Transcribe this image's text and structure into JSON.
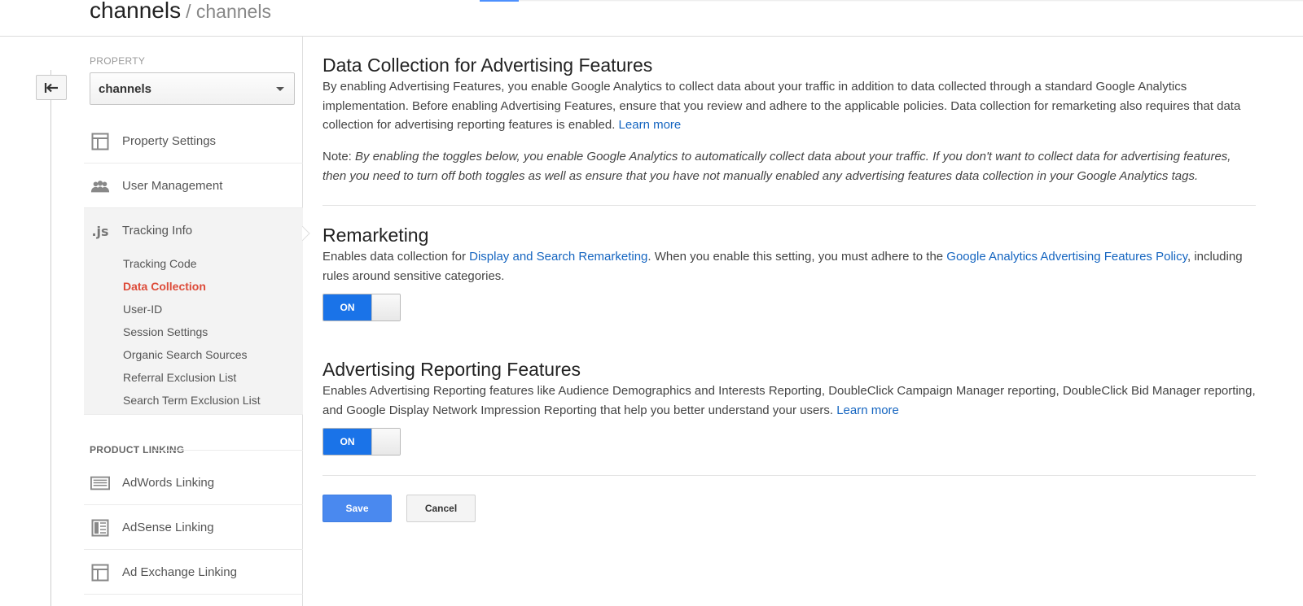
{
  "header": {
    "title": "channels",
    "breadcrumb": "/ channels"
  },
  "sidebar": {
    "property_heading": "PROPERTY",
    "property_select_value": "channels",
    "items": [
      {
        "label": "Property Settings",
        "icon": "layout-icon"
      },
      {
        "label": "User Management",
        "icon": "users-icon"
      },
      {
        "label": "Tracking Info",
        "icon": "js-icon"
      }
    ],
    "tracking_sub": [
      {
        "label": "Tracking Code"
      },
      {
        "label": "Data Collection"
      },
      {
        "label": "User-ID"
      },
      {
        "label": "Session Settings"
      },
      {
        "label": "Organic Search Sources"
      },
      {
        "label": "Referral Exclusion List"
      },
      {
        "label": "Search Term Exclusion List"
      }
    ],
    "product_linking_heading": "PRODUCT LINKING",
    "linking_items": [
      {
        "label": "AdWords Linking",
        "icon": "adwords-icon"
      },
      {
        "label": "AdSense Linking",
        "icon": "adsense-icon"
      },
      {
        "label": "Ad Exchange Linking",
        "icon": "adexchange-icon"
      }
    ],
    "active_color": "#dd4b39"
  },
  "main": {
    "data_collection": {
      "title": "Data Collection for Advertising Features",
      "body": "By enabling Advertising Features, you enable Google Analytics to collect data about your traffic in addition to data collected through a standard Google Analytics implementation. Before enabling Advertising Features, ensure that you review and adhere to the applicable policies. Data collection for remarketing also requires that data collection for advertising reporting features is enabled.",
      "learn_more": "Learn more",
      "note_label": "Note:",
      "note_text": "By enabling the toggles below, you enable Google Analytics to automatically collect data about your traffic. If you don't want to collect data for advertising features, then you need to turn off both toggles as well as ensure that you have not manually enabled any advertising features data collection in your Google Analytics tags."
    },
    "remarketing": {
      "title": "Remarketing",
      "text_1": "Enables data collection for",
      "link_1": "Display and Search Remarketing",
      "text_2": ". When you enable this setting, you must adhere to the",
      "link_2": "Google Analytics Advertising Features Policy",
      "text_3": ", including rules around sensitive categories.",
      "toggle_label": "ON"
    },
    "advertising_reporting": {
      "title": "Advertising Reporting Features",
      "body": "Enables Advertising Reporting features like Audience Demographics and Interests Reporting, DoubleClick Campaign Manager reporting, DoubleClick Bid Manager reporting, and Google Display Network Impression Reporting that help you better understand your users.",
      "learn_more": "Learn more",
      "toggle_label": "ON"
    },
    "actions": {
      "save_label": "Save",
      "cancel_label": "Cancel"
    },
    "link_color": "#1565c0",
    "toggle_on_color": "#1a73e8",
    "save_color": "#4a89ef"
  }
}
